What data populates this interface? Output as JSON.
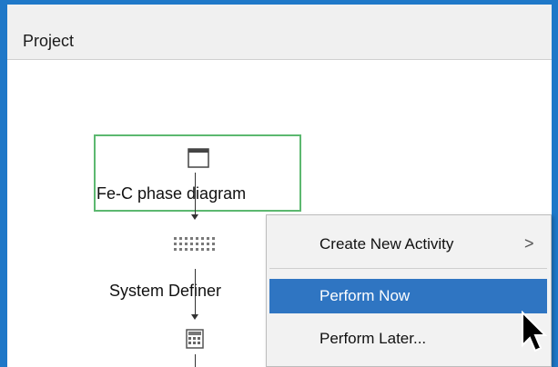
{
  "window": {
    "title": "Project",
    "accent_color": "#1f78c8"
  },
  "nodes": [
    {
      "label": "Fe-C phase diagram",
      "icon": "window-icon",
      "selected": true,
      "selection_color": "#5cb870"
    },
    {
      "label": "System Definer",
      "icon": "grid-dots-icon",
      "selected": false
    },
    {
      "label": "",
      "icon": "calculator-icon",
      "selected": false
    }
  ],
  "context_menu": {
    "items": [
      {
        "label": "Create New Activity",
        "submenu_icon": "chevron-right-icon",
        "chevron": ">",
        "highlighted": false
      },
      {
        "label": "Perform Now",
        "highlighted": true
      },
      {
        "label": "Perform Later...",
        "highlighted": false
      }
    ],
    "highlight_color": "#2f75c2"
  },
  "cursor": {
    "icon": "arrow-cursor-icon"
  }
}
